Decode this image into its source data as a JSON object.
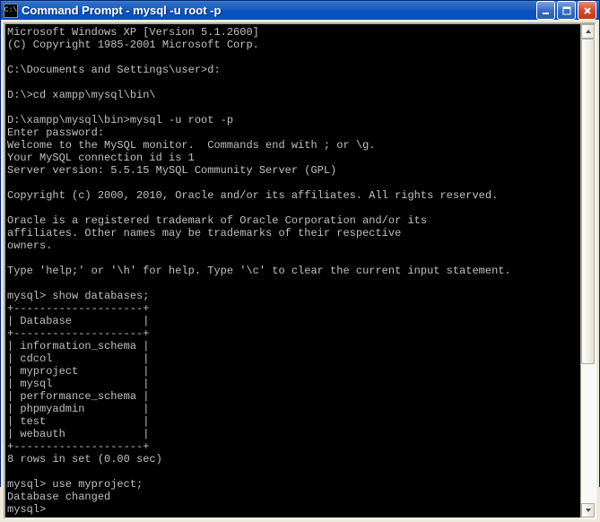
{
  "window": {
    "icon_text": "C:\\",
    "title": "Command Prompt - mysql -u root -p"
  },
  "buttons": {
    "minimize": "minimize",
    "maximize": "maximize",
    "close": "close"
  },
  "console": {
    "lines": [
      "Microsoft Windows XP [Version 5.1.2600]",
      "(C) Copyright 1985-2001 Microsoft Corp.",
      "",
      "C:\\Documents and Settings\\user>d:",
      "",
      "D:\\>cd xampp\\mysql\\bin\\",
      "",
      "D:\\xampp\\mysql\\bin>mysql -u root -p",
      "Enter password:",
      "Welcome to the MySQL monitor.  Commands end with ; or \\g.",
      "Your MySQL connection id is 1",
      "Server version: 5.5.15 MySQL Community Server (GPL)",
      "",
      "Copyright (c) 2000, 2010, Oracle and/or its affiliates. All rights reserved.",
      "",
      "Oracle is a registered trademark of Oracle Corporation and/or its",
      "affiliates. Other names may be trademarks of their respective",
      "owners.",
      "",
      "Type 'help;' or '\\h' for help. Type '\\c' to clear the current input statement.",
      "",
      "mysql> show databases;",
      "+--------------------+",
      "| Database           |",
      "+--------------------+",
      "| information_schema |",
      "| cdcol              |",
      "| myproject          |",
      "| mysql              |",
      "| performance_schema |",
      "| phpmyadmin         |",
      "| test               |",
      "| webauth            |",
      "+--------------------+",
      "8 rows in set (0.00 sec)",
      "",
      "mysql> use myproject;",
      "Database changed",
      "mysql>"
    ]
  }
}
